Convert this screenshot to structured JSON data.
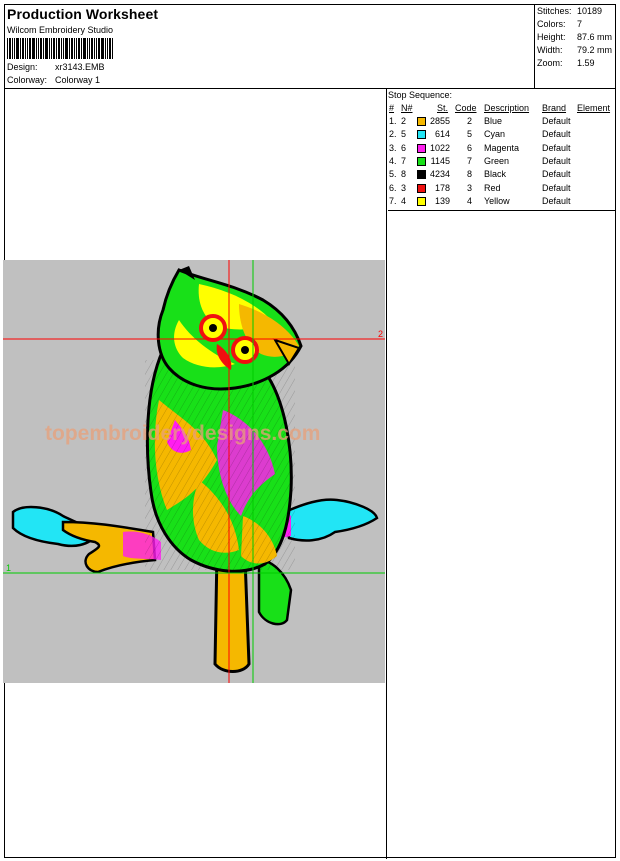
{
  "header": {
    "title": "Production Worksheet",
    "company": "Wilcom  Embroidery Studio",
    "design_label": "Design:",
    "design_value": "xr3143.EMB",
    "colorway_label": "Colorway:",
    "colorway_value": "Colorway  1"
  },
  "stats": {
    "stitches_label": "Stitches:",
    "stitches_value": "10189",
    "colors_label": "Colors:",
    "colors_value": "7",
    "height_label": "Height:",
    "height_value": "87.6 mm",
    "width_label": "Width:",
    "width_value": "79.2 mm",
    "zoom_label": "Zoom:",
    "zoom_value": "1.59"
  },
  "preview": {
    "guide_label_1": "1",
    "guide_label_2": "2",
    "watermark": "topembroiderydesigns.com"
  },
  "stop_sequence": {
    "title": "Stop Sequence:",
    "headers": [
      "#",
      "N#",
      "St.",
      "Code",
      "Description",
      "Brand",
      "Element"
    ],
    "rows": [
      {
        "num": "1.",
        "n": "2",
        "color": "#f5b800",
        "st": "2855",
        "code": "2",
        "desc": "Blue",
        "brand": "Default"
      },
      {
        "num": "2.",
        "n": "5",
        "color": "#22e5f5",
        "st": "614",
        "code": "5",
        "desc": "Cyan",
        "brand": "Default"
      },
      {
        "num": "3.",
        "n": "6",
        "color": "#ff1ef0",
        "st": "1022",
        "code": "6",
        "desc": "Magenta",
        "brand": "Default"
      },
      {
        "num": "4.",
        "n": "7",
        "color": "#18e018",
        "st": "1145",
        "code": "7",
        "desc": "Green",
        "brand": "Default"
      },
      {
        "num": "5.",
        "n": "8",
        "color": "#000000",
        "st": "4234",
        "code": "8",
        "desc": "Black",
        "brand": "Default"
      },
      {
        "num": "6.",
        "n": "3",
        "color": "#f01010",
        "st": "178",
        "code": "3",
        "desc": "Red",
        "brand": "Default"
      },
      {
        "num": "7.",
        "n": "4",
        "color": "#ffff00",
        "st": "139",
        "code": "4",
        "desc": "Yellow",
        "brand": "Default"
      }
    ]
  }
}
